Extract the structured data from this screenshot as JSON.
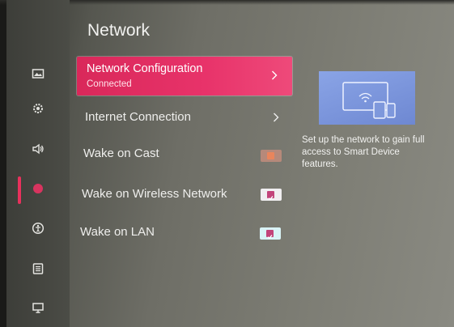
{
  "page": {
    "title": "Network"
  },
  "sidebar": {
    "items": [
      {
        "name": "picture",
        "icon": "picture-icon",
        "active": false
      },
      {
        "name": "general",
        "icon": "general-icon",
        "active": false
      },
      {
        "name": "sound",
        "icon": "sound-icon",
        "active": false
      },
      {
        "name": "network",
        "icon": "network-icon",
        "active": true
      },
      {
        "name": "accessibility",
        "icon": "accessibility-icon",
        "active": false
      },
      {
        "name": "system",
        "icon": "system-icon",
        "active": false
      },
      {
        "name": "support",
        "icon": "support-icon",
        "active": false
      }
    ]
  },
  "menu": {
    "network_configuration": {
      "label": "Network Configuration",
      "status": "Connected",
      "icon": "chevron-right-icon"
    },
    "internet_connection": {
      "label": "Internet Connection",
      "icon": "chevron-right-icon"
    },
    "wake_on_cast": {
      "label": "Wake on Cast",
      "checked": false
    },
    "wake_on_wireless": {
      "label": "Wake on Wireless Network",
      "checked": true
    },
    "wake_on_lan": {
      "label": "Wake on LAN",
      "checked": true
    }
  },
  "info": {
    "illustration": "tv-wifi-devices-icon",
    "description": "Set up the network to gain full access to Smart Device features."
  },
  "colors": {
    "accent": "#e8336a",
    "toggle_on": "#c2447a",
    "toggle_off": "#e07a55",
    "promo": "#7e98dc"
  }
}
